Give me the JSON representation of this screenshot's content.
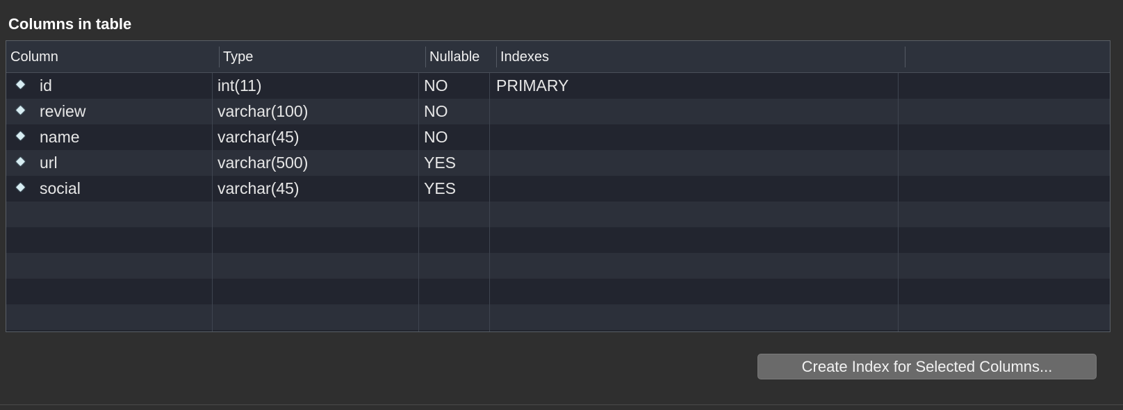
{
  "section": {
    "title": "Columns in table"
  },
  "table": {
    "headers": [
      "Column",
      "Type",
      "Nullable",
      "Indexes"
    ],
    "rows": [
      {
        "column": "id",
        "type": "int(11)",
        "nullable": "NO",
        "indexes": "PRIMARY"
      },
      {
        "column": "review",
        "type": "varchar(100)",
        "nullable": "NO",
        "indexes": ""
      },
      {
        "column": "name",
        "type": "varchar(45)",
        "nullable": "NO",
        "indexes": ""
      },
      {
        "column": "url",
        "type": "varchar(500)",
        "nullable": "YES",
        "indexes": ""
      },
      {
        "column": "social",
        "type": "varchar(45)",
        "nullable": "YES",
        "indexes": ""
      }
    ],
    "row_icon": "diamond-icon"
  },
  "actions": {
    "create_index_label": "Create Index for Selected Columns..."
  },
  "colors": {
    "background": "#2f2f2f",
    "header": "#2d323c",
    "row_odd": "#22252f",
    "row_even": "#2c303a",
    "button": "#6a6a6a"
  }
}
